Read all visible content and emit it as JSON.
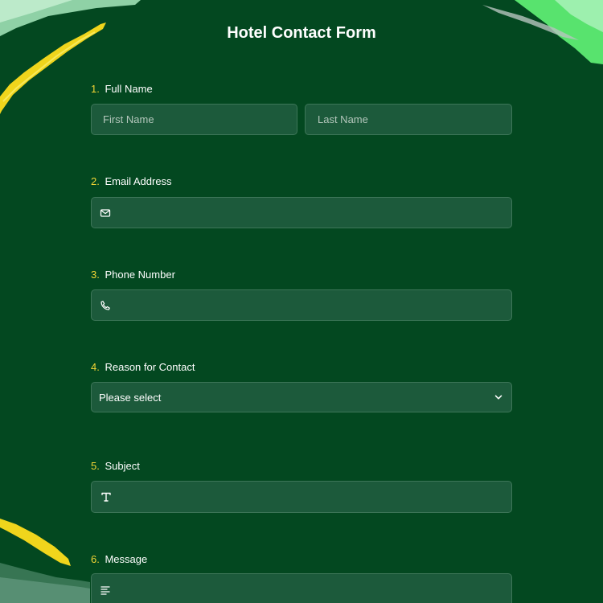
{
  "form": {
    "title": "Hotel Contact Form"
  },
  "questions": [
    {
      "number": "1.",
      "label": "Full Name"
    },
    {
      "number": "2.",
      "label": "Email Address"
    },
    {
      "number": "3.",
      "label": "Phone Number"
    },
    {
      "number": "4.",
      "label": "Reason for Contact"
    },
    {
      "number": "5.",
      "label": "Subject"
    },
    {
      "number": "6.",
      "label": "Message"
    }
  ],
  "fields": {
    "first_name_placeholder": "First Name",
    "last_name_placeholder": "Last Name",
    "email_icon": "envelope-icon",
    "phone_icon": "phone-icon",
    "reason_selected": "Please select",
    "subject_icon": "text-icon",
    "message_icon": "paragraph-icon"
  },
  "colors": {
    "background": "#034820",
    "field_background": "#1c5a3b",
    "number_accent": "#f2d535",
    "deco_green": "#56e06d",
    "deco_yellow": "#f5e21c"
  }
}
